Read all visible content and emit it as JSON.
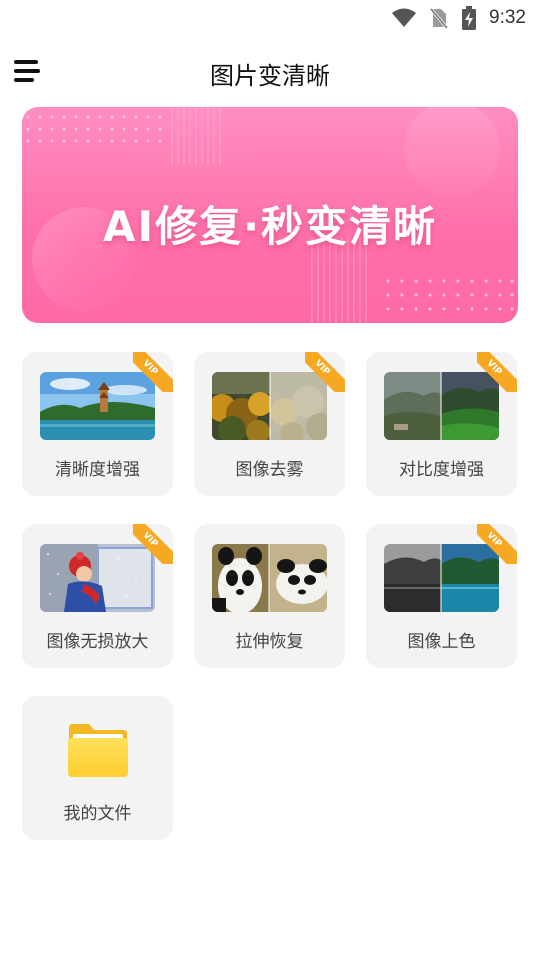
{
  "status_bar": {
    "time": "9:32",
    "icons": [
      "wifi-icon",
      "no-sim-icon",
      "battery-charging-icon"
    ]
  },
  "header": {
    "menu_icon": "menu-icon",
    "title": "图片变清晰"
  },
  "banner": {
    "text": "AI修复·秒变清晰"
  },
  "tools": [
    {
      "label": "清晰度增强",
      "vip": true,
      "vip_label": "VIP"
    },
    {
      "label": "图像去雾",
      "vip": true,
      "vip_label": "VIP"
    },
    {
      "label": "对比度增强",
      "vip": true,
      "vip_label": "VIP"
    },
    {
      "label": "图像无损放大",
      "vip": true,
      "vip_label": "VIP"
    },
    {
      "label": "拉伸恢复",
      "vip": false
    },
    {
      "label": "图像上色",
      "vip": true,
      "vip_label": "VIP"
    },
    {
      "label": "我的文件",
      "vip": false,
      "icon": "folder-icon"
    }
  ],
  "colors": {
    "banner_pink": "#ff6fa8",
    "vip_orange": "#f7a823",
    "card_bg": "#f3f3f3",
    "folder_yellow": "#fdcf2f"
  }
}
